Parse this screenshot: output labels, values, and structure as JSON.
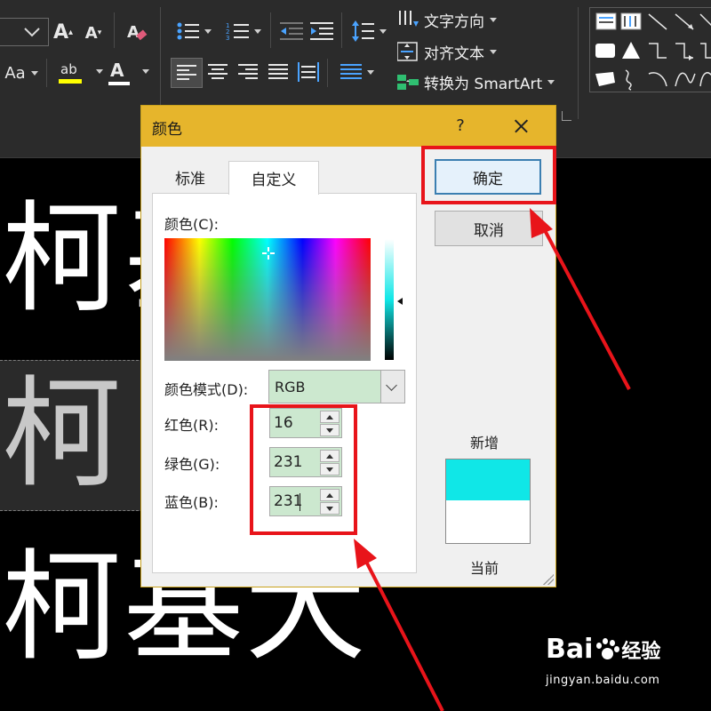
{
  "ribbon": {
    "font_size_toggle": "Aa",
    "font_color_letter": "A",
    "highlight_letters": "ab",
    "grow_font_letter": "A",
    "shrink_font_letter": "A",
    "text_direction_label": "文字方向",
    "align_text_label": "对齐文本",
    "convert_smartart_label": "转换为 SmartArt"
  },
  "slide": {
    "line1": "柯",
    "line2": "柯",
    "line3": "柯基犬"
  },
  "dialog": {
    "title": "颜色",
    "help": "?",
    "tabs": [
      "标准",
      "自定义"
    ],
    "colors_label": "颜色(C):",
    "color_model_label": "颜色模式(D):",
    "color_model_value": "RGB",
    "red_label": "红色(R):",
    "red_value": "16",
    "green_label": "绿色(G):",
    "green_value": "231",
    "blue_label": "蓝色(B):",
    "blue_value": "231",
    "ok_label": "确定",
    "cancel_label": "取消",
    "new_label": "新增",
    "current_label": "当前"
  },
  "preview": {
    "new_color": "#10e7e7",
    "current_color": "#ffffff"
  },
  "colors": {
    "annotation_red": "#e8141a",
    "title_bar": "#e6b52c",
    "input_bg": "#cce8cf"
  },
  "watermark": {
    "brand_left": "Bai",
    "brand_right": "经验",
    "url": "jingyan.baidu.com"
  }
}
